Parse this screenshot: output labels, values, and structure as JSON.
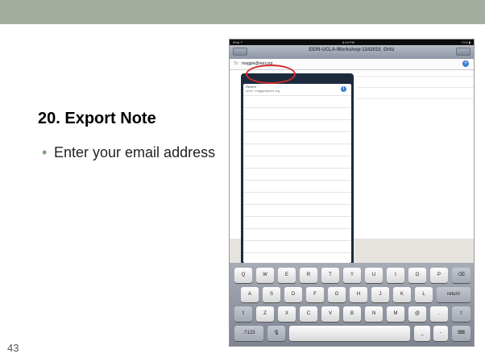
{
  "slide": {
    "title": "20. Export Note",
    "bullet": "Enter your email address",
    "bullet_marker": "•",
    "page_number": "43"
  },
  "ipad": {
    "status": {
      "carrier": "iPad ⇡",
      "time": "8:19 PM",
      "battery": "71% ▮"
    },
    "nav_title": "EERI-UCLA-Workshop-1242015_Ortiz",
    "to_label": "To:",
    "to_value": "maggie@eeri.org",
    "recent_label": "Recent",
    "recent_entry_label": "other",
    "recent_entry_email": "maggie@eeri.org",
    "keyboard": {
      "row1": [
        "Q",
        "W",
        "E",
        "R",
        "T",
        "Y",
        "U",
        "I",
        "O",
        "P"
      ],
      "row2": [
        "A",
        "S",
        "D",
        "F",
        "G",
        "H",
        "J",
        "K",
        "L"
      ],
      "row3": [
        "Z",
        "X",
        "C",
        "V",
        "B",
        "N",
        "M",
        "@",
        "."
      ],
      "return": "return",
      "numbers": ".?123",
      "underscore": "_",
      "dash": "-"
    }
  },
  "colors": {
    "top_bar": "#a3ada0",
    "highlight_circle": "#cf2a2a",
    "bullet_marker": "#7fa07a"
  }
}
